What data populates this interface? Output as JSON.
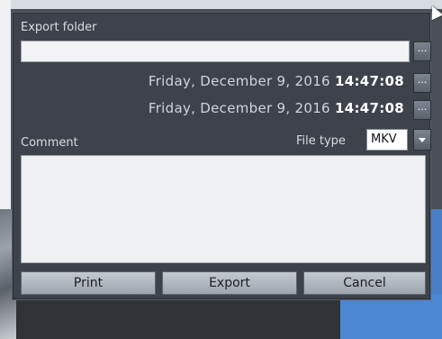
{
  "dialog": {
    "export_folder_label": "Export folder",
    "export_folder_value": "",
    "start_date": "Friday, December 9, 2016",
    "start_time": "14:47:08",
    "end_date": "Friday, December 9, 2016",
    "end_time": "14:47:08",
    "browse_label": "...",
    "comment_label": "Comment",
    "file_type_label": "File type",
    "file_type_value": "MKV",
    "comment_value": "",
    "buttons": {
      "print": "Print",
      "export": "Export",
      "cancel": "Cancel"
    }
  }
}
